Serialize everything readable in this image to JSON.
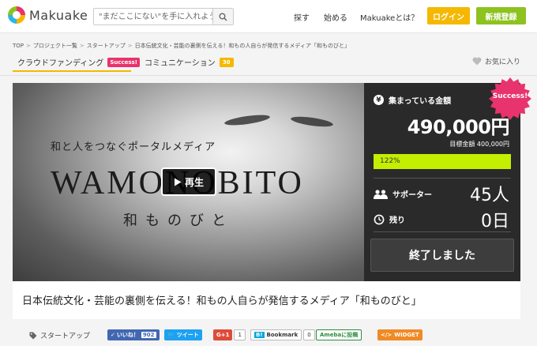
{
  "header": {
    "logo_text": "Makuake",
    "search_placeholder": "\"まだここにない\"を手に入れよう",
    "nav": [
      "探す",
      "始める",
      "Makuakeとは？"
    ],
    "login_label": "ログイン",
    "register_label": "新規登録"
  },
  "breadcrumb": [
    "TOP",
    "プロジェクト一覧",
    "スタートアップ",
    "日本伝統文化・芸能の裏側を伝える！和もの人自らが発信するメディア「和ものびと」"
  ],
  "tabs": {
    "crowdfunding": "クラウドファンディング",
    "success_badge": "Success!",
    "communication": "コミュニケーション",
    "communication_count": "30",
    "favorite": "お気に入り"
  },
  "video": {
    "subtitle": "和と人をつなぐポータルメディア",
    "title": "WAMONOBITO",
    "kana": "和ものびと",
    "play_label": "再生"
  },
  "funding": {
    "raised_label": "集まっている金額",
    "amount": "490,000円",
    "target": "目標金額 400,000円",
    "progress_text": "122%",
    "progress_fraction": 1.0,
    "supporters_label": "サポーター",
    "supporters_count": "45人",
    "remaining_label": "残り",
    "remaining_days": "0日",
    "ended_label": "終了しました",
    "success_label": "Success!"
  },
  "project": {
    "title": "日本伝統文化・芸能の裏側を伝える！和もの人自らが発信するメディア「和ものびと」",
    "category": "スタートアップ"
  },
  "share": {
    "like_label": "いいね！",
    "like_count": "902",
    "tweet_label": "ツイート",
    "gplus_label": "G+1",
    "gplus_count": "1",
    "bookmark_label": "Bookmark",
    "bookmark_count": "0",
    "ameba_label": "Amebaに投稿",
    "widget_label": "WIDGET"
  },
  "colors": {
    "accent_yellow": "#f5b800",
    "success_pink": "#e8336d",
    "progress_green": "#c4ef00",
    "register_green": "#8dc21f",
    "panel_dark": "#2a2a2a"
  }
}
